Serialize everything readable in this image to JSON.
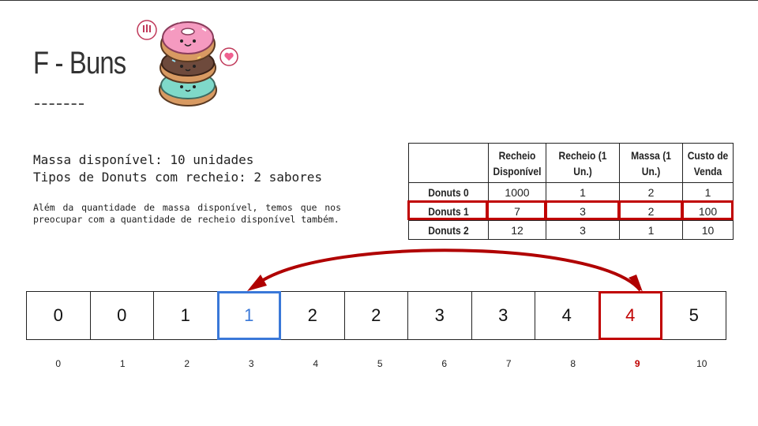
{
  "title": "F - Buns",
  "info": {
    "line1": "Massa disponível: 10 unidades",
    "line2": "Tipos de Donuts com recheio: 2 sabores",
    "note": "Além da quantidade de massa disponível, temos que nos preocupar com a quantidade de recheio disponível também."
  },
  "table": {
    "headers": [
      "",
      "Recheio Disponível",
      "Recheio (1 Un.)",
      "Massa (1 Un.)",
      "Custo de Venda"
    ],
    "rows": [
      {
        "name": "Donuts 0",
        "cells": [
          "1000",
          "1",
          "2",
          "1"
        ]
      },
      {
        "name": "Donuts 1",
        "cells": [
          "7",
          "3",
          "2",
          "100"
        ]
      },
      {
        "name": "Donuts 2",
        "cells": [
          "12",
          "3",
          "1",
          "10"
        ]
      }
    ],
    "highlight_row": 1
  },
  "dp": {
    "values": [
      "0",
      "0",
      "1",
      "1",
      "2",
      "2",
      "3",
      "3",
      "4",
      "4",
      "5"
    ],
    "indices": [
      "0",
      "1",
      "2",
      "3",
      "4",
      "5",
      "6",
      "7",
      "8",
      "9",
      "10"
    ],
    "highlight_blue": 3,
    "highlight_red": 9
  },
  "colors": {
    "red": "#c00000",
    "blue": "#3a78d8"
  },
  "icons": [
    "donut-stack-icon",
    "exclamation-bubble-icon",
    "heart-bubble-icon",
    "curved-arrow-icon"
  ]
}
